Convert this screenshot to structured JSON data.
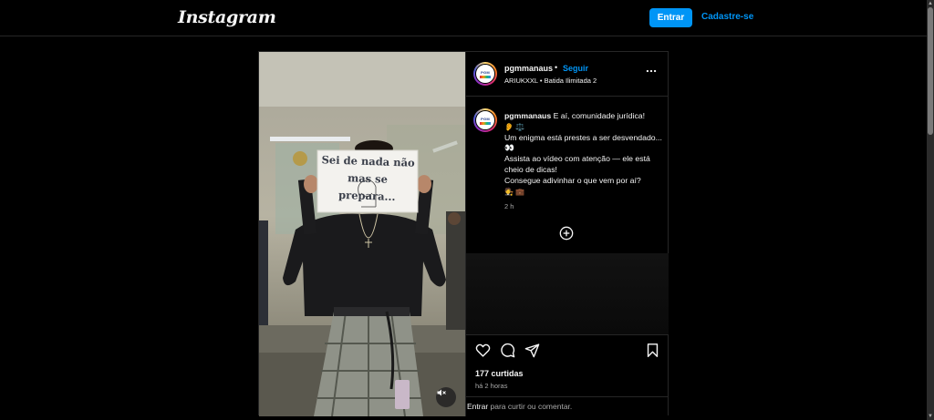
{
  "nav": {
    "logo": "Instagram",
    "login_button": "Entrar",
    "signup_link": "Cadastre-se"
  },
  "post": {
    "header": {
      "username": "pgmmanaus",
      "separator": "•",
      "follow": "Seguir",
      "audio_artist": "ARIUKXXL",
      "audio_separator": "•",
      "audio_track": "Batida Ilimitada 2",
      "more_icon": "more-horizontal-icon"
    },
    "avatar_label": "PGM",
    "media": {
      "sign_line1": "Sei de nada não",
      "sign_line2": "mas se prepara...",
      "mute_icon": "volume-muted-icon"
    },
    "caption": {
      "username": "pgmmanaus",
      "text_line1": " E aí, comunidade jurídica!",
      "line1_emoji": "👂 ⚖️",
      "text_line2": "Um enigma está prestes a ser desvendado... 👀",
      "text_line3": "Assista ao vídeo com atenção — ele está cheio de dicas!",
      "text_line4": "Consegue adivinhar o que vem por aí?",
      "line4_emoji": "🧑‍⚖️ 💼",
      "time": "2 h"
    },
    "add_comment_icon": "plus-circle-icon",
    "actions": {
      "like_icon": "heart-icon",
      "comment_icon": "comment-icon",
      "share_icon": "send-icon",
      "save_icon": "bookmark-icon"
    },
    "likes": "177 curtidas",
    "posted_ago": "há 2 horas",
    "login_prompt": {
      "link": "Entrar",
      "text": " para curtir ou comentar."
    }
  },
  "colors": {
    "accent": "#0095f6",
    "background": "#000000",
    "border": "#262626",
    "text_secondary": "#a8a8a8"
  }
}
